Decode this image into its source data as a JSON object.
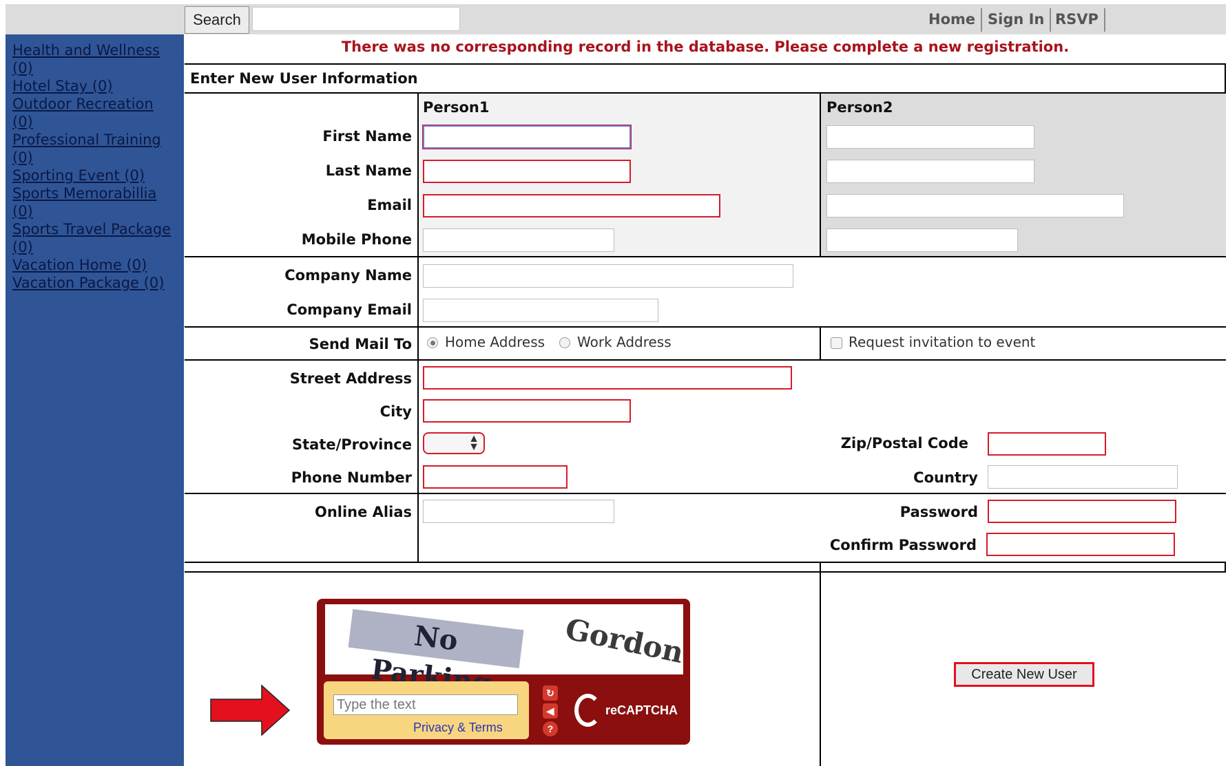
{
  "header": {
    "search_label": "Search",
    "search_value": "",
    "nav": [
      "Home",
      "Sign In",
      "RSVP"
    ]
  },
  "sidebar": {
    "items": [
      {
        "line1": "Health and Wellness",
        "line2": "(0)"
      },
      {
        "line1": "Hotel Stay (0)",
        "line2": ""
      },
      {
        "line1": "Outdoor Recreation",
        "line2": "(0)"
      },
      {
        "line1": "Professional Training",
        "line2": "(0)"
      },
      {
        "line1": "Sporting Event (0)",
        "line2": ""
      },
      {
        "line1": "Sports Memorabillia",
        "line2": "(0)"
      },
      {
        "line1": "Sports Travel Package",
        "line2": "(0)"
      },
      {
        "line1": "Vacation Home (0)",
        "line2": ""
      },
      {
        "line1": "Vacation Package (0)",
        "line2": ""
      }
    ]
  },
  "message": "There was no corresponding record in the database. Please complete a new registration.",
  "form": {
    "section_title": "Enter New User Information",
    "person1": "Person1",
    "person2": "Person2",
    "labels": {
      "first_name": "First Name",
      "last_name": "Last Name",
      "email": "Email",
      "mobile_phone": "Mobile Phone",
      "company_name": "Company Name",
      "company_email": "Company Email",
      "send_mail_to": "Send Mail To",
      "street_address": "Street Address",
      "city": "City",
      "state_province": "State/Province",
      "phone_number": "Phone Number",
      "zip_postal_code": "Zip/Postal Code",
      "country": "Country",
      "online_alias": "Online Alias",
      "password": "Password",
      "confirm_password": "Confirm Password"
    },
    "send_mail_options": [
      "Home Address",
      "Work Address"
    ],
    "send_mail_selected": "Home Address",
    "request_invitation": "Request invitation to event",
    "state_value": ""
  },
  "captcha": {
    "word1": "No Parking",
    "word2": "Gordon",
    "placeholder": "Type the text",
    "privacy": "Privacy & Terms",
    "logo_text": "reCAPTCHA"
  },
  "submit_label": "Create New User",
  "colors": {
    "sidebar_bg": "#2f5597",
    "error_text": "#a8141c",
    "required_border": "#d51b2b",
    "captcha_bg": "#8b0f0f",
    "arrow": "#e3101e"
  }
}
